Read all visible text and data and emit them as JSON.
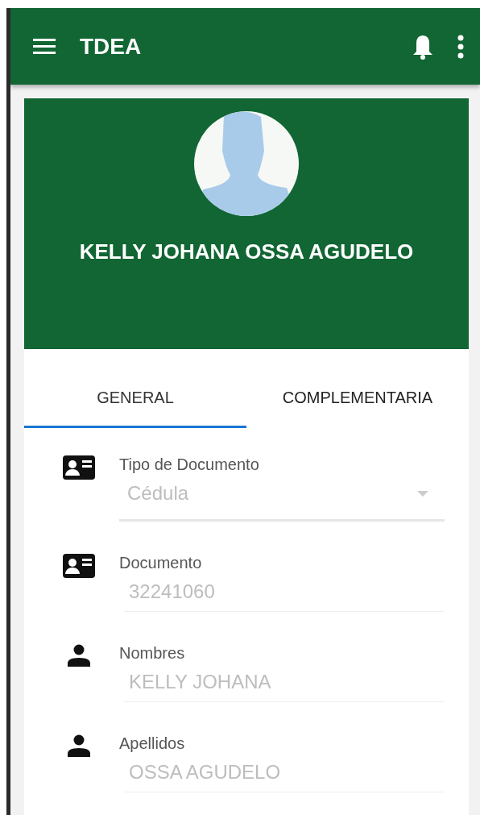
{
  "app_bar": {
    "title": "TDEA"
  },
  "profile": {
    "name": "KELLY JOHANA OSSA AGUDELO"
  },
  "tabs": [
    {
      "label": "GENERAL",
      "selected": true
    },
    {
      "label": "COMPLEMENTARIA",
      "selected": false
    }
  ],
  "fields": [
    {
      "kind": "select",
      "label": "Tipo de Documento",
      "value": "Cédula",
      "disabled": true
    },
    {
      "kind": "text",
      "label": "Documento",
      "value": "32241060",
      "disabled": true
    },
    {
      "kind": "text",
      "label": "Nombres",
      "value": "KELLY JOHANA",
      "disabled": true
    },
    {
      "kind": "text",
      "label": "Apellidos",
      "value": "OSSA AGUDELO",
      "disabled": true
    }
  ]
}
